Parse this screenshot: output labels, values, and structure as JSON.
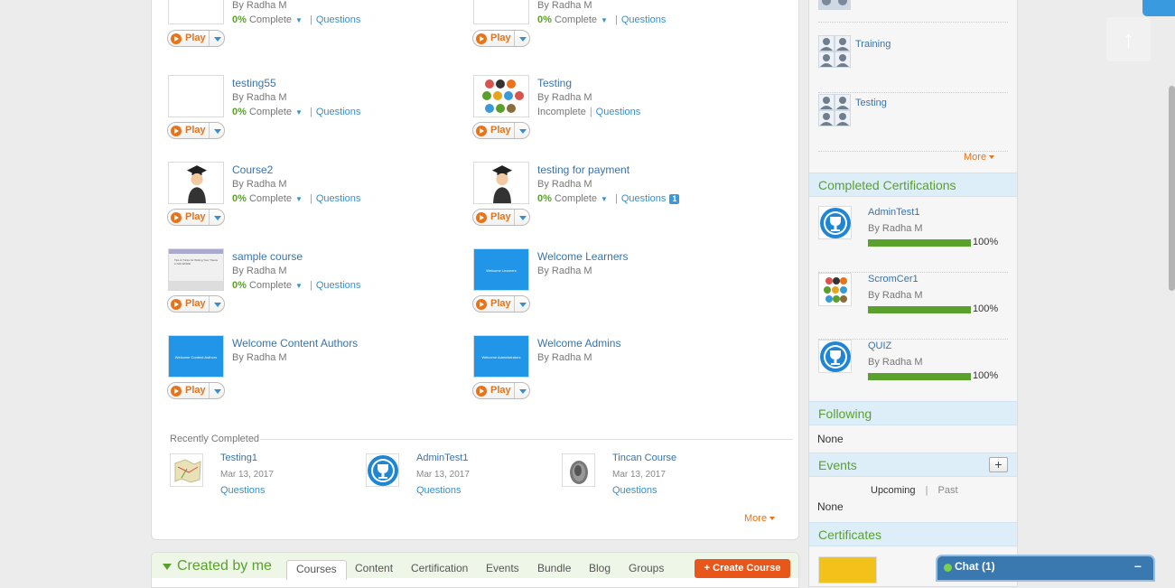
{
  "courses": [
    {
      "title": "",
      "by": "By Radha M",
      "pct": "0%",
      "status": "Complete",
      "link": "Questions",
      "play": "Play"
    },
    {
      "title": "",
      "by": "By Radha M",
      "pct": "0%",
      "status": "Complete",
      "link": "Questions",
      "play": "Play"
    },
    {
      "title": "testing55",
      "by": "By Radha M",
      "pct": "0%",
      "status": "Complete",
      "link": "Questions",
      "play": "Play"
    },
    {
      "title": "Testing",
      "by": "By Radha M",
      "pct": "",
      "status": "Incomplete",
      "link": "Questions",
      "play": "Play"
    },
    {
      "title": "Course2",
      "by": "By Radha M",
      "pct": "0%",
      "status": "Complete",
      "link": "Questions",
      "play": "Play"
    },
    {
      "title": "testing for payment",
      "by": "By Radha M",
      "pct": "0%",
      "status": "Complete",
      "link": "Questions",
      "badge": "1",
      "play": "Play"
    },
    {
      "title": "sample course",
      "by": "By Radha M",
      "pct": "0%",
      "status": "Complete",
      "link": "Questions",
      "play": "Play",
      "thumb_text": "Tips & Tricks for Writing Your Thesis in MS WORD"
    },
    {
      "title": "Welcome Learners",
      "by": "By Radha M",
      "play": "Play",
      "thumb_text": "Welcome Learners"
    },
    {
      "title": "Welcome Content Authors",
      "by": "By Radha M",
      "play": "Play",
      "thumb_text": "Welcome Content Authors"
    },
    {
      "title": "Welcome Admins",
      "by": "By Radha M",
      "play": "Play",
      "thumb_text": "Welcome Administrators"
    }
  ],
  "recent": {
    "title": "Recently Completed",
    "items": [
      {
        "title": "Testing1",
        "date": "Mar 13, 2017",
        "link": "Questions"
      },
      {
        "title": "AdminTest1",
        "date": "Mar 13, 2017",
        "link": "Questions"
      },
      {
        "title": "Tincan Course",
        "date": "Mar 13, 2017",
        "link": "Questions"
      }
    ],
    "more": "More"
  },
  "created": {
    "title": "Created by me",
    "tabs": [
      "Courses",
      "Content",
      "Certification",
      "Events",
      "Bundle",
      "Blog",
      "Groups"
    ],
    "create_button": "+ Create Course"
  },
  "sidebar": {
    "groups": [
      {
        "label": ""
      },
      {
        "label": "Training"
      },
      {
        "label": "Testing"
      }
    ],
    "groups_more": "More",
    "completed_cert_title": "Completed Certifications",
    "certs": [
      {
        "title": "AdminTest1",
        "by": "By Radha M",
        "pct": "100%",
        "progress": 1.0
      },
      {
        "title": "ScromCer1",
        "by": "By Radha M",
        "pct": "100%",
        "progress": 1.0
      },
      {
        "title": "QUIZ",
        "by": "By Radha M",
        "pct": "100%",
        "progress": 1.0
      }
    ],
    "following_title": "Following",
    "following_value": "None",
    "events_title": "Events",
    "events_add": "+",
    "events_upcoming": "Upcoming",
    "events_sep": "|",
    "events_past": "Past",
    "events_value": "None",
    "certificates_title": "Certificates"
  },
  "chat": {
    "label": "Chat  (1)",
    "minimize": "–"
  },
  "colors": {
    "accent_green": "#5aa02c",
    "accent_orange": "#e8731a",
    "link_blue": "#3a8fc8"
  }
}
